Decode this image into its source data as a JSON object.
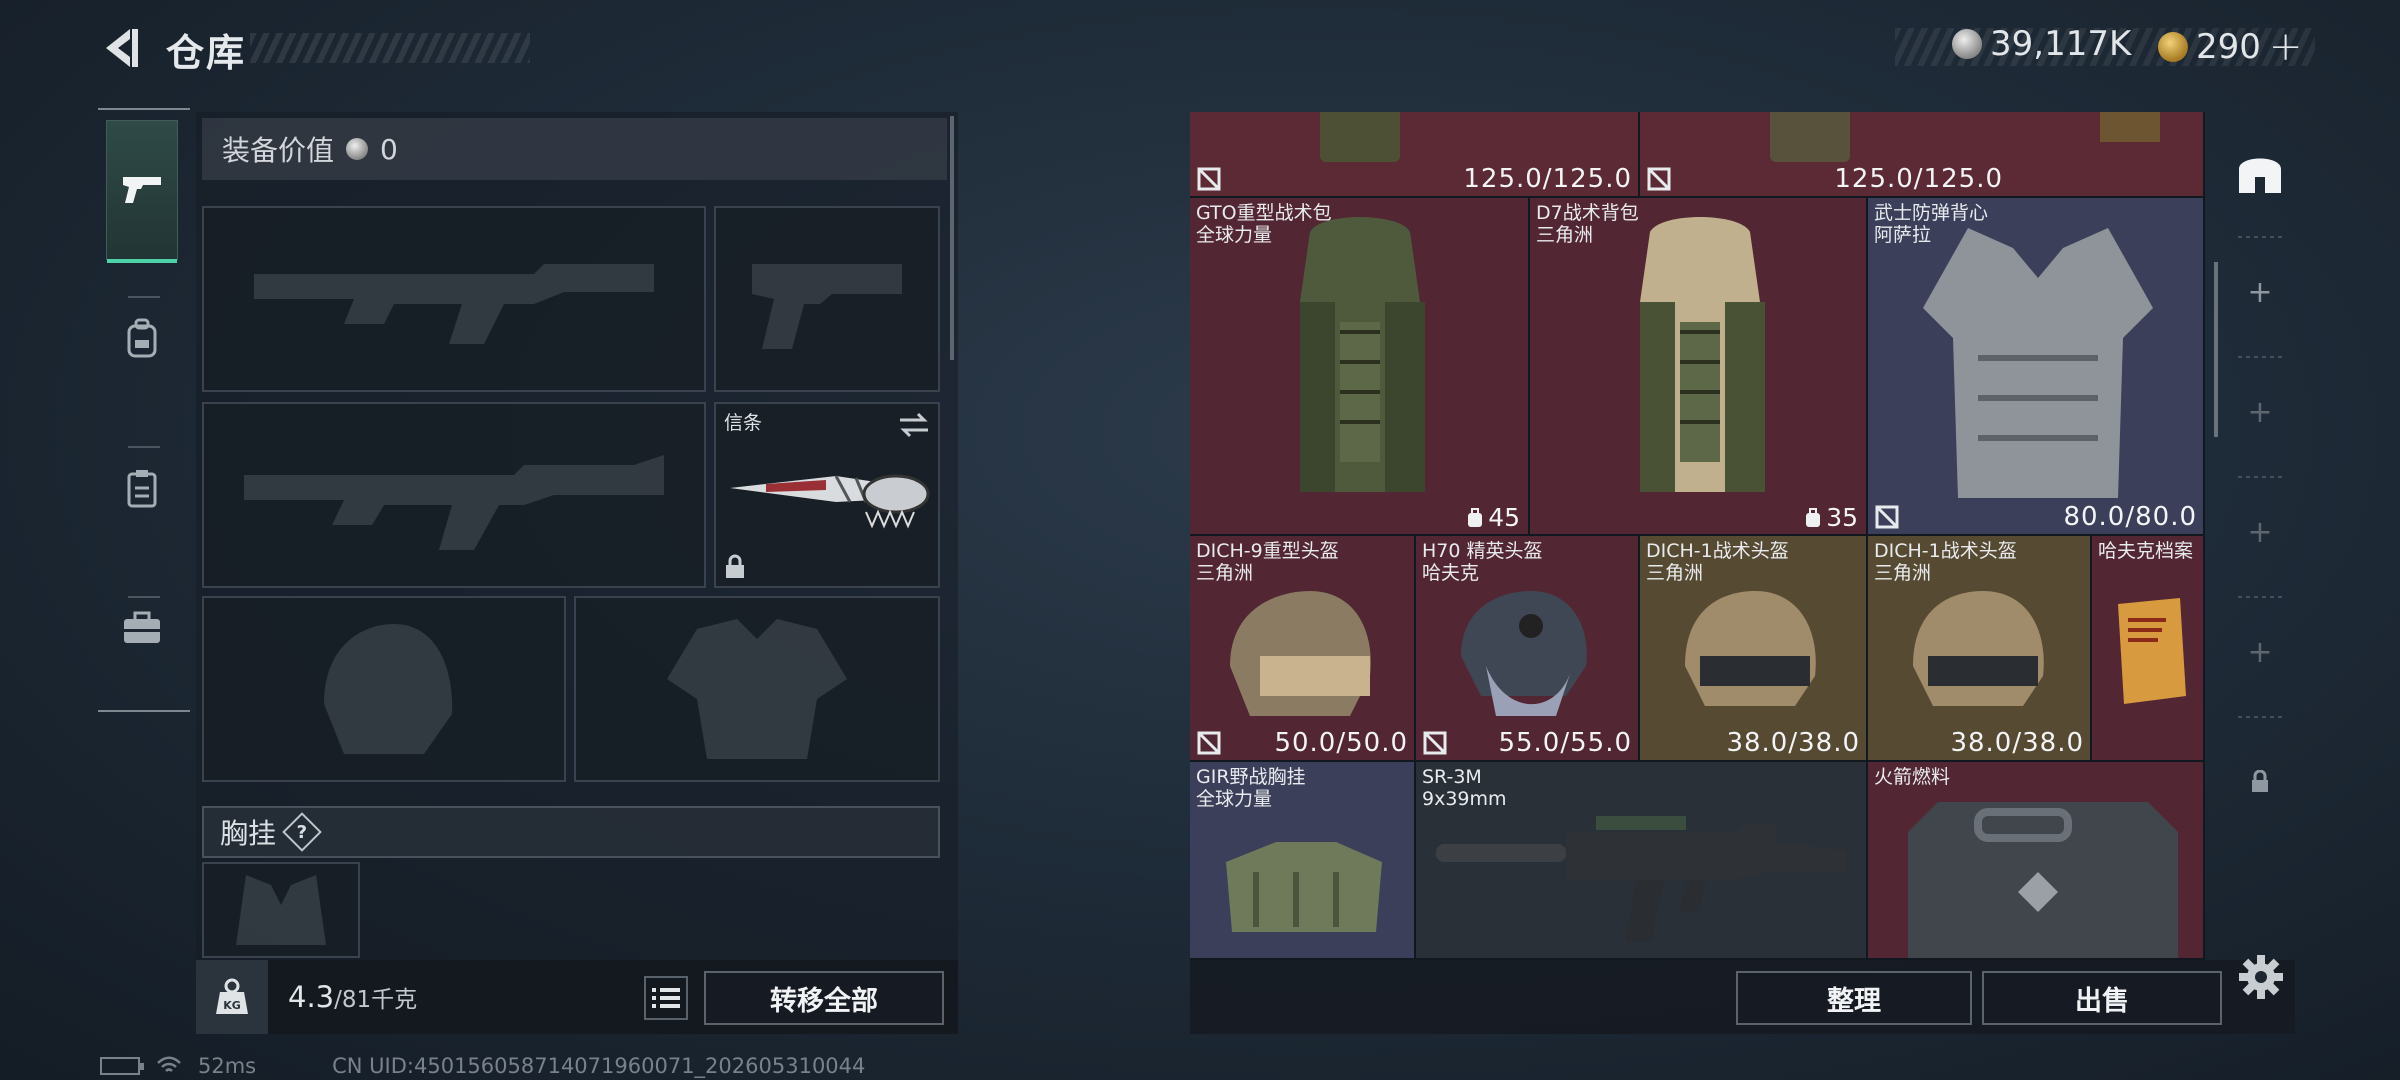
{
  "header": {
    "title": "仓库"
  },
  "currency": {
    "coins": "39,117K",
    "tickets": "290"
  },
  "loadout": {
    "value_label": "装备价值",
    "value": "0",
    "melee_label": "信条",
    "chest_rig_label": "胸挂",
    "help": "?"
  },
  "footer": {
    "weight": "4.3",
    "weight_max": "/81千克",
    "transfer_all": "转移全部",
    "organize": "整理",
    "sell": "出售"
  },
  "storage": {
    "top_row": {
      "left_durability": "125.0/125.0",
      "right_durability": "125.0/125.0"
    },
    "items": [
      {
        "name": "GTO重型战术包",
        "sub": "全球力量",
        "capacity": "45"
      },
      {
        "name": "D7战术背包",
        "sub": "三角洲",
        "capacity": "35"
      },
      {
        "name": "武士防弹背心",
        "sub": "阿萨拉",
        "durability": "80.0/80.0"
      },
      {
        "name": "DICH-9重型头盔",
        "sub": "三角洲",
        "durability": "50.0/50.0"
      },
      {
        "name": "H70 精英头盔",
        "sub": "哈夫克",
        "durability": "55.0/55.0"
      },
      {
        "name": "DICH-1战术头盔",
        "sub": "三角洲",
        "durability": "38.0/38.0"
      },
      {
        "name": "DICH-1战术头盔",
        "sub": "三角洲",
        "durability": "38.0/38.0"
      },
      {
        "name": "哈夫克档案",
        "sub": ""
      },
      {
        "name": "GIR野战胸挂",
        "sub": "全球力量"
      },
      {
        "name": "SR-3M",
        "sub": "9x39mm"
      },
      {
        "name": "火箭燃料",
        "sub": ""
      }
    ]
  },
  "status": {
    "ping": "52ms",
    "uid": "CN UID:450156058714071960071_202605310044"
  },
  "colors": {
    "accent": "#4ed2a8",
    "cell_red": "#5b2a35",
    "cell_blue": "#3c3f59",
    "cell_gold": "#574a33"
  }
}
